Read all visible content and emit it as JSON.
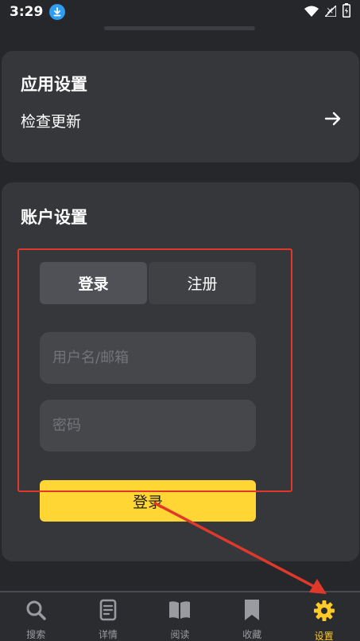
{
  "status": {
    "time": "3:29"
  },
  "app_settings": {
    "title": "应用设置",
    "check_update_label": "检查更新"
  },
  "account_settings": {
    "title": "账户设置",
    "tabs": [
      {
        "label": "登录",
        "active": true
      },
      {
        "label": "注册",
        "active": false
      }
    ],
    "username_placeholder": "用户名/邮箱",
    "password_placeholder": "密码",
    "login_button": "登录"
  },
  "bottom_nav": {
    "items": [
      {
        "label": "搜索",
        "icon": "search-icon",
        "active": false
      },
      {
        "label": "详情",
        "icon": "document-icon",
        "active": false
      },
      {
        "label": "阅读",
        "icon": "book-icon",
        "active": false
      },
      {
        "label": "收藏",
        "icon": "bookmark-icon",
        "active": false
      },
      {
        "label": "设置",
        "icon": "gear-icon",
        "active": true
      }
    ]
  },
  "colors": {
    "background": "#26272b",
    "card": "#36373b",
    "accent": "#ffd633",
    "active_nav": "#ffc928",
    "annotation": "#e0392b"
  }
}
